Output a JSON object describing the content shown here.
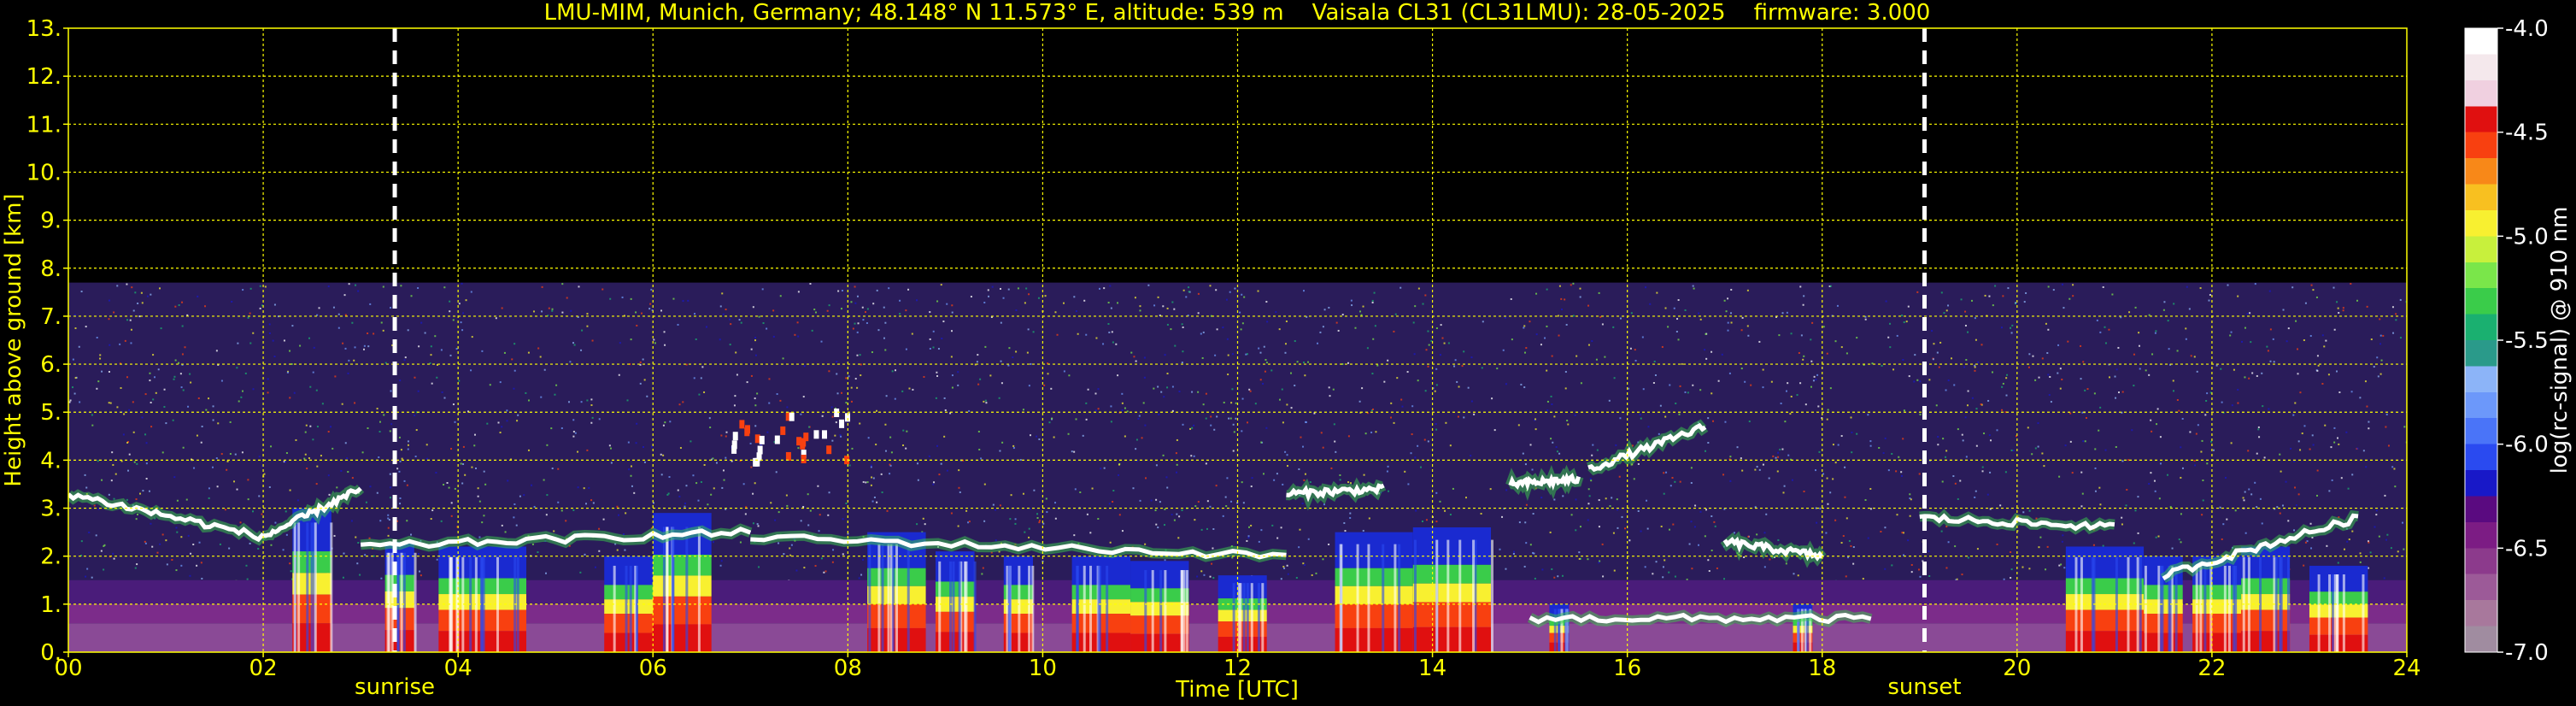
{
  "chart_data": {
    "type": "heatmap",
    "title": "LMU-MIM, Munich, Germany; 48.148° N 11.573° E, altitude: 539 m    Vaisala CL31 (CL31LMU): 28-05-2025    firmware: 3.000",
    "xlabel": "Time [UTC]",
    "ylabel": "Height above ground [km]",
    "xlim": [
      0,
      24
    ],
    "ylim": [
      0,
      13
    ],
    "x_ticks": [
      "00",
      "02",
      "04",
      "06",
      "08",
      "10",
      "12",
      "14",
      "16",
      "18",
      "20",
      "22",
      "24"
    ],
    "y_ticks": [
      "0.",
      "1.",
      "2.",
      "3.",
      "4.",
      "5.",
      "6.",
      "7.",
      "8.",
      "9.",
      "10.",
      "11.",
      "12.",
      "13."
    ],
    "grid": true,
    "signal_top_km": 7.7,
    "markers": [
      {
        "label": "sunrise",
        "time_h": 3.35
      },
      {
        "label": "sunset",
        "time_h": 19.05
      }
    ],
    "colorbar": {
      "label": "log(rc-signal) @ 910 nm",
      "range": [
        -7.0,
        -4.0
      ],
      "ticks": [
        "-4.0",
        "-4.5",
        "-5.0",
        "-5.5",
        "-6.0",
        "-6.5",
        "-7.0"
      ],
      "colors": [
        "#a08ca0",
        "#a8789c",
        "#9c5a98",
        "#8c3a8c",
        "#7c1c84",
        "#5a0a80",
        "#1818c8",
        "#2a4af0",
        "#4a74f8",
        "#6c98fa",
        "#8cb4f8",
        "#2a9a8a",
        "#1ab070",
        "#3acc4a",
        "#7ae64a",
        "#c8f03c",
        "#f8f030",
        "#f8c020",
        "#f88818",
        "#f84010",
        "#e01010",
        "#f0d0e0",
        "#f4e8ec",
        "#ffffff"
      ]
    },
    "cloud_layers": [
      {
        "t0": 0.0,
        "t1": 2.0,
        "h0": 3.3,
        "h1": 2.4
      },
      {
        "t0": 2.0,
        "t1": 3.0,
        "h0": 2.4,
        "h1": 3.4
      },
      {
        "t0": 3.0,
        "t1": 7.0,
        "h0": 2.2,
        "h1": 2.5
      },
      {
        "t0": 7.0,
        "t1": 12.5,
        "h0": 2.4,
        "h1": 2.0
      },
      {
        "t0": 12.5,
        "t1": 13.5,
        "h0": 3.3,
        "h1": 3.4
      },
      {
        "t0": 14.8,
        "t1": 15.5,
        "h0": 3.5,
        "h1": 3.6
      },
      {
        "t0": 15.6,
        "t1": 16.8,
        "h0": 3.8,
        "h1": 4.7
      },
      {
        "t0": 15.0,
        "t1": 18.5,
        "h0": 0.7,
        "h1": 0.7
      },
      {
        "t0": 17.0,
        "t1": 18.0,
        "h0": 2.3,
        "h1": 2.0
      },
      {
        "t0": 19.0,
        "t1": 21.0,
        "h0": 2.8,
        "h1": 2.6
      },
      {
        "t0": 21.5,
        "t1": 23.5,
        "h0": 1.6,
        "h1": 2.8
      }
    ],
    "high_patches": [
      {
        "t0": 6.8,
        "t1": 8.0,
        "h0": 4.0,
        "h1": 5.1
      }
    ],
    "precip_blocks": [
      {
        "t0": 2.3,
        "t1": 2.7,
        "top": 3.0
      },
      {
        "t0": 3.25,
        "t1": 3.55,
        "top": 2.3
      },
      {
        "t0": 3.8,
        "t1": 4.2,
        "top": 2.2
      },
      {
        "t0": 4.1,
        "t1": 4.7,
        "top": 2.2
      },
      {
        "t0": 5.5,
        "t1": 6.1,
        "top": 2.0
      },
      {
        "t0": 6.0,
        "t1": 6.6,
        "top": 2.9
      },
      {
        "t0": 8.2,
        "t1": 8.8,
        "top": 2.5
      },
      {
        "t0": 8.9,
        "t1": 9.3,
        "top": 2.1
      },
      {
        "t0": 9.6,
        "t1": 9.9,
        "top": 2.0
      },
      {
        "t0": 10.3,
        "t1": 10.9,
        "top": 2.0
      },
      {
        "t0": 10.9,
        "t1": 11.5,
        "top": 1.9
      },
      {
        "t0": 11.8,
        "t1": 12.3,
        "top": 1.6
      },
      {
        "t0": 13.0,
        "t1": 13.8,
        "top": 2.5
      },
      {
        "t0": 13.8,
        "t1": 14.6,
        "top": 2.6
      },
      {
        "t0": 15.2,
        "t1": 15.4,
        "top": 1.0
      },
      {
        "t0": 17.7,
        "t1": 17.9,
        "top": 1.0
      },
      {
        "t0": 20.5,
        "t1": 21.3,
        "top": 2.2
      },
      {
        "t0": 21.3,
        "t1": 21.7,
        "top": 2.0
      },
      {
        "t0": 21.8,
        "t1": 22.3,
        "top": 2.0
      },
      {
        "t0": 22.3,
        "t1": 22.8,
        "top": 2.2
      },
      {
        "t0": 23.0,
        "t1": 23.6,
        "top": 1.8
      }
    ]
  }
}
